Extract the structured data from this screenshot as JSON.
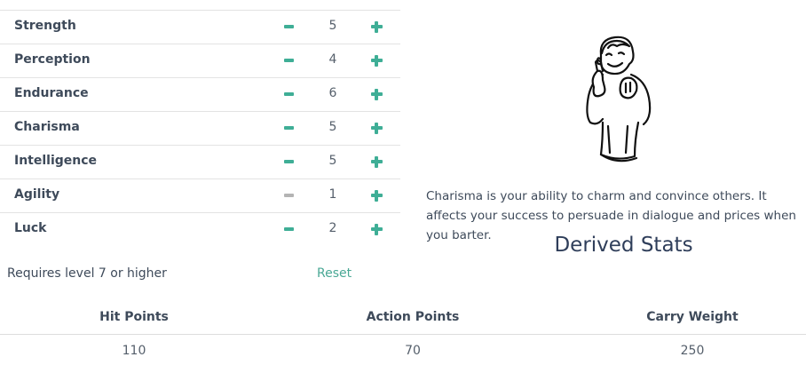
{
  "special": {
    "stats": [
      {
        "name": "Strength",
        "value": "5",
        "minus_enabled": true
      },
      {
        "name": "Perception",
        "value": "4",
        "minus_enabled": true
      },
      {
        "name": "Endurance",
        "value": "6",
        "minus_enabled": true
      },
      {
        "name": "Charisma",
        "value": "5",
        "minus_enabled": true
      },
      {
        "name": "Intelligence",
        "value": "5",
        "minus_enabled": true
      },
      {
        "name": "Agility",
        "value": "1",
        "minus_enabled": false
      },
      {
        "name": "Luck",
        "value": "2",
        "minus_enabled": true
      }
    ],
    "requires_text": "Requires level 7 or higher",
    "reset_label": "Reset"
  },
  "detail": {
    "image_icon": "vault-boy-thumbs-up",
    "description": "Charisma is your ability to charm and convince others. It affects your success to persuade in dialogue and prices when you barter."
  },
  "derived": {
    "title": "Derived Stats",
    "headers": [
      "Hit Points",
      "Action Points",
      "Carry Weight"
    ],
    "values": [
      "110",
      "70",
      "250"
    ]
  },
  "colors": {
    "accent": "#3fae96",
    "disabled": "#b4b4b4",
    "text": "#3e4a5a",
    "title": "#2f3e5a"
  }
}
